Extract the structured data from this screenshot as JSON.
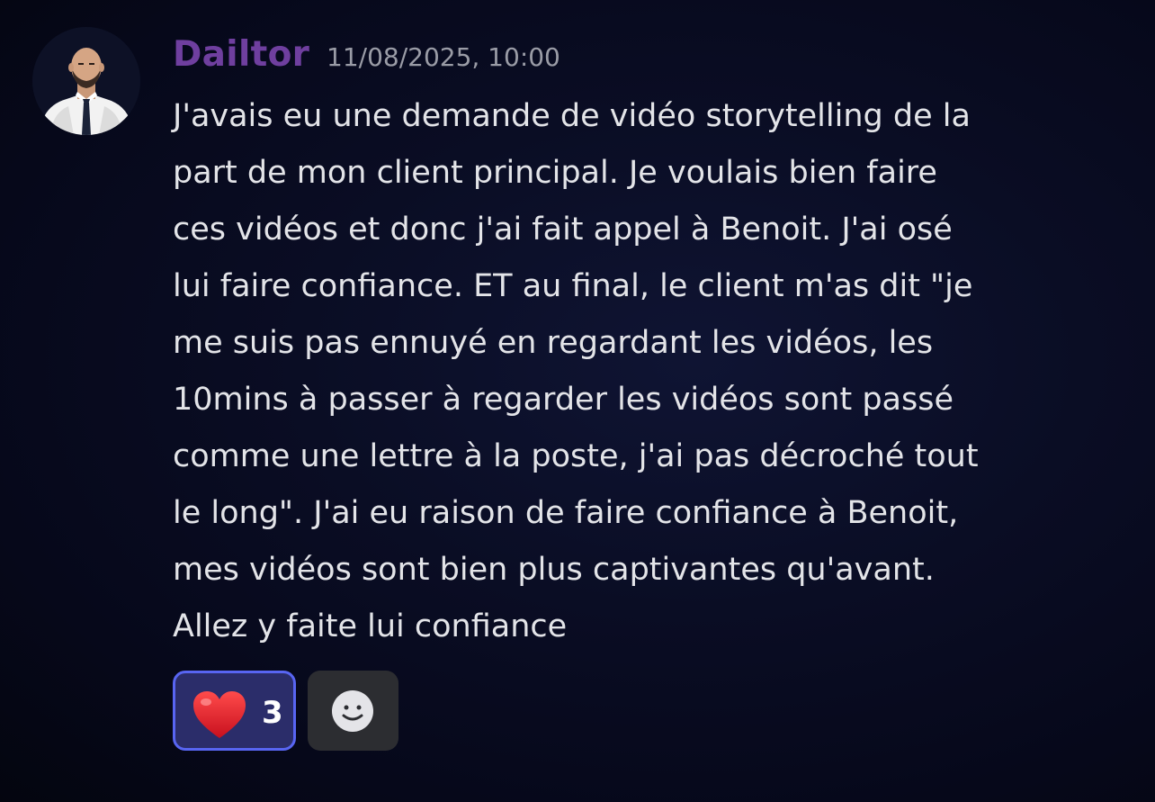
{
  "message": {
    "author": "Dailtor",
    "author_color": "#6f3f9f",
    "timestamp": "11/08/2025, 10:00",
    "lines": [
      "J'avais eu une demande de vidéo storytelling de la",
      "part de mon client principal. Je voulais bien faire",
      "ces vidéos et donc j'ai fait appel à Benoit. J'ai osé",
      "lui faire confiance. ET au final, le client m'as dit \"je",
      "me suis pas ennuyé en regardant les vidéos, les",
      "10mins à passer à regarder les vidéos sont passé",
      "comme une lettre à la poste, j'ai pas décroché tout",
      "le long\". J'ai eu raison de faire confiance à Benoit,",
      "mes vidéos sont bien plus captivantes qu'avant.",
      "Allez y faite lui confiance"
    ]
  },
  "reactions": [
    {
      "emoji": "heart-icon",
      "count": "3",
      "active": true
    }
  ],
  "add_reaction": {
    "icon": "smiley-icon"
  },
  "colors": {
    "reaction_border": "#5865f2",
    "reaction_bg": "#2b2d6a",
    "add_reaction_bg": "#2c2d31"
  }
}
